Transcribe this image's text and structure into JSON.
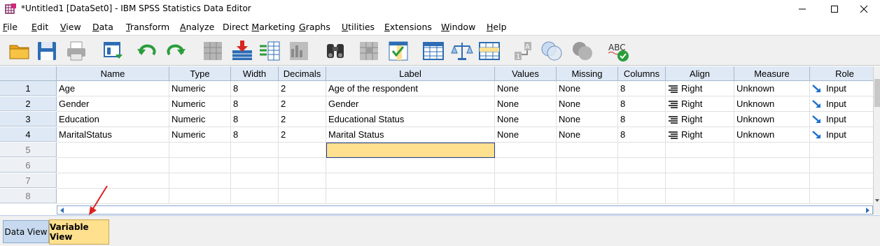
{
  "window": {
    "title": "*Untitled1 [DataSet0] - IBM SPSS Statistics Data Editor"
  },
  "menu": [
    {
      "label": "File",
      "mnemonic": "F",
      "rest": "ile"
    },
    {
      "label": "Edit",
      "mnemonic": "E",
      "rest": "dit"
    },
    {
      "label": "View",
      "mnemonic": "V",
      "rest": "iew"
    },
    {
      "label": "Data",
      "mnemonic": "D",
      "rest": "ata"
    },
    {
      "label": "Transform",
      "mnemonic": "T",
      "rest": "ransform"
    },
    {
      "label": "Analyze",
      "mnemonic": "A",
      "rest": "nalyze"
    },
    {
      "label": "Direct Marketing",
      "pre": "Direct ",
      "mnemonic": "M",
      "rest": "arketing"
    },
    {
      "label": "Graphs",
      "mnemonic": "G",
      "rest": "raphs"
    },
    {
      "label": "Utilities",
      "mnemonic": "U",
      "rest": "tilities"
    },
    {
      "label": "Extensions",
      "mnemonic": "E",
      "rest": "xtensions"
    },
    {
      "label": "Window",
      "mnemonic": "W",
      "rest": "indow"
    },
    {
      "label": "Help",
      "mnemonic": "H",
      "rest": "elp"
    }
  ],
  "toolbar_icons": [
    "open-file-icon",
    "save-icon",
    "print-icon",
    "dialog-recall-icon",
    "undo-icon",
    "redo-icon",
    "go-to-case-icon",
    "go-to-variable-icon",
    "variables-icon",
    "run-descriptives-icon",
    "find-icon",
    "insert-cases-icon",
    "insert-variable-icon",
    "split-file-icon",
    "weight-cases-icon",
    "select-cases-icon",
    "value-labels-icon",
    "use-variable-sets-icon",
    "show-all-variables-icon",
    "spell-check-icon"
  ],
  "grid": {
    "columns": [
      "Name",
      "Type",
      "Width",
      "Decimals",
      "Label",
      "Values",
      "Missing",
      "Columns",
      "Align",
      "Measure",
      "Role"
    ],
    "rows": [
      {
        "num": "1",
        "name": "Age",
        "type": "Numeric",
        "width": "8",
        "decimals": "2",
        "label": "Age of the respondent",
        "values": "None",
        "missing": "None",
        "columns": "8",
        "align": "Right",
        "measure": "Unknown",
        "role": "Input"
      },
      {
        "num": "2",
        "name": "Gender",
        "type": "Numeric",
        "width": "8",
        "decimals": "2",
        "label": "Gender",
        "values": "None",
        "missing": "None",
        "columns": "8",
        "align": "Right",
        "measure": "Unknown",
        "role": "Input"
      },
      {
        "num": "3",
        "name": "Education",
        "type": "Numeric",
        "width": "8",
        "decimals": "2",
        "label": "Educational Status",
        "values": "None",
        "missing": "None",
        "columns": "8",
        "align": "Right",
        "measure": "Unknown",
        "role": "Input"
      },
      {
        "num": "4",
        "name": "MaritalStatus",
        "type": "Numeric",
        "width": "8",
        "decimals": "2",
        "label": "Marital Status",
        "values": "None",
        "missing": "None",
        "columns": "8",
        "align": "Right",
        "measure": "Unknown",
        "role": "Input"
      }
    ],
    "empty_rows": [
      "5",
      "6",
      "7",
      "8"
    ]
  },
  "tabs": {
    "data_view": "Data View",
    "variable_view": "Variable View"
  },
  "colors": {
    "header_bg": "#dfe9f5",
    "selected_cell": "#ffe08e",
    "active_tab": "#ffe08e",
    "annotation_arrow": "#e02020"
  }
}
